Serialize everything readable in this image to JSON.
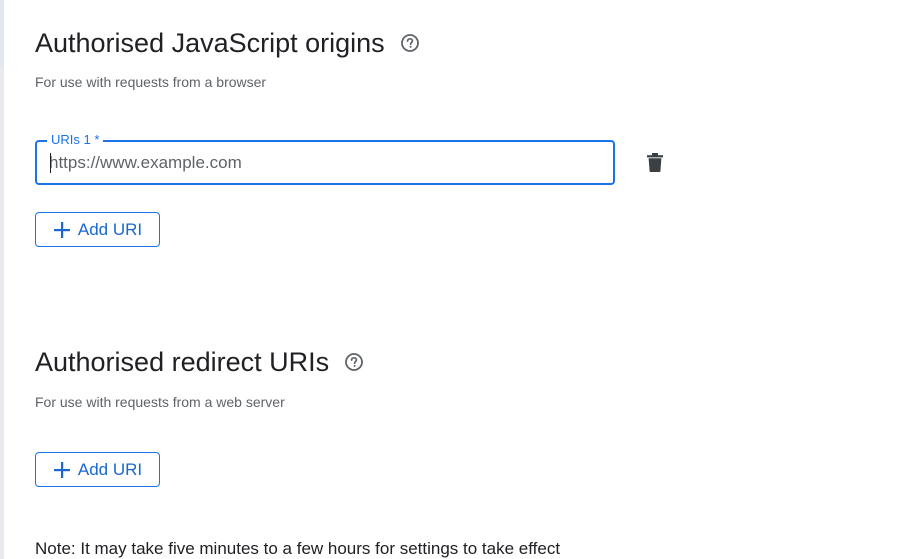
{
  "js_origins": {
    "title": "Authorised JavaScript origins",
    "help_icon": "help-circle-icon",
    "description": "For use with requests from a browser",
    "uri_field": {
      "label": "URIs 1 *",
      "value": "",
      "placeholder": "https://www.example.com"
    },
    "delete_icon": "trash-icon",
    "add_button": {
      "icon": "plus-icon",
      "label": "Add URI"
    }
  },
  "redirect_uris": {
    "title": "Authorised redirect URIs",
    "help_icon": "help-circle-icon",
    "description": "For use with requests from a web server",
    "add_button": {
      "icon": "plus-icon",
      "label": "Add URI"
    }
  },
  "note": "Note: It may take five minutes to a few hours for settings to take effect",
  "colors": {
    "accent": "#1a73e8",
    "text_primary": "#202124",
    "text_secondary": "#5f6368"
  }
}
